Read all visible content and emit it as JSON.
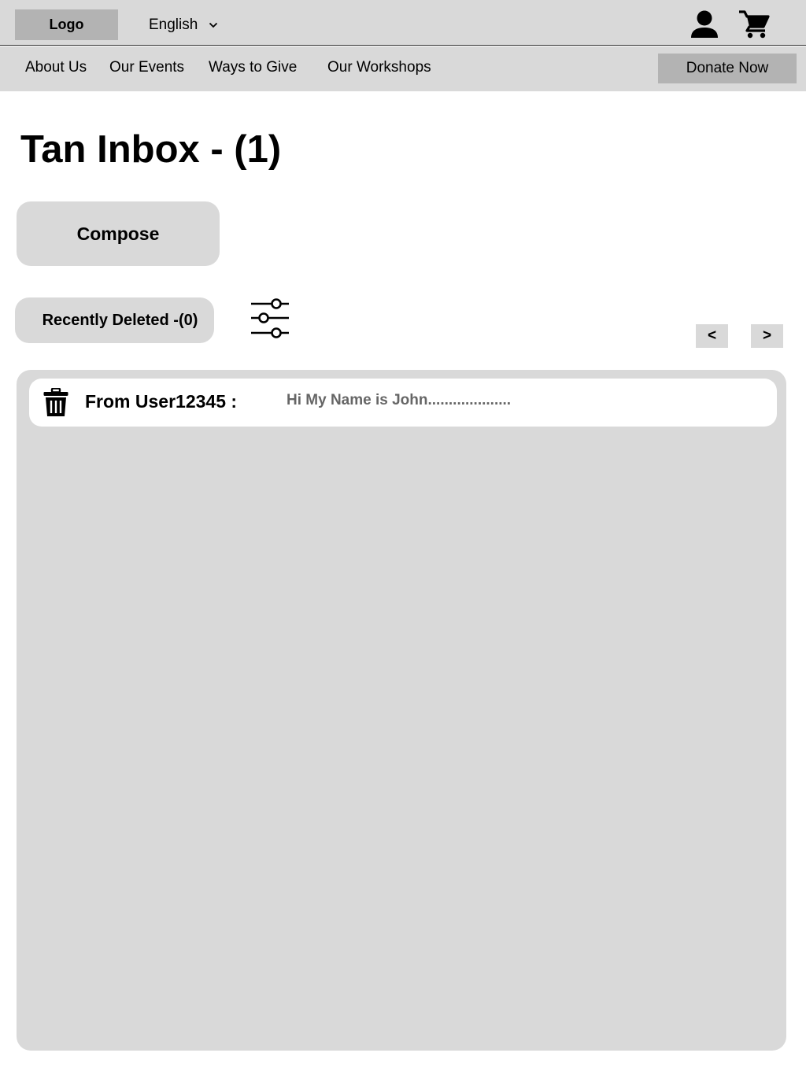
{
  "header": {
    "logo_label": "Logo",
    "language": {
      "selected": "English",
      "icon": "chevron-down-icon"
    },
    "icons": {
      "user": "user-icon",
      "cart": "cart-icon"
    }
  },
  "nav": {
    "items": [
      {
        "label": "About Us"
      },
      {
        "label": "Our Events"
      },
      {
        "label": "Ways to Give"
      },
      {
        "label": "Our Workshops"
      }
    ],
    "donate_label": "Donate Now"
  },
  "main": {
    "title": "Tan Inbox - (1)",
    "compose_label": "Compose",
    "recently_deleted_label": "Recently Deleted -(0)",
    "filter_icon": "sliders-icon",
    "pager": {
      "prev_label": "<",
      "next_label": ">"
    },
    "messages": [
      {
        "sender": "From User12345 :",
        "preview": "Hi My Name is John....................",
        "icon": "trash-icon"
      }
    ]
  },
  "colors": {
    "bar_bg": "#d9d9d9",
    "button_dark": "#b3b3b3",
    "preview_text": "#666666",
    "page_bg": "#ffffff"
  }
}
